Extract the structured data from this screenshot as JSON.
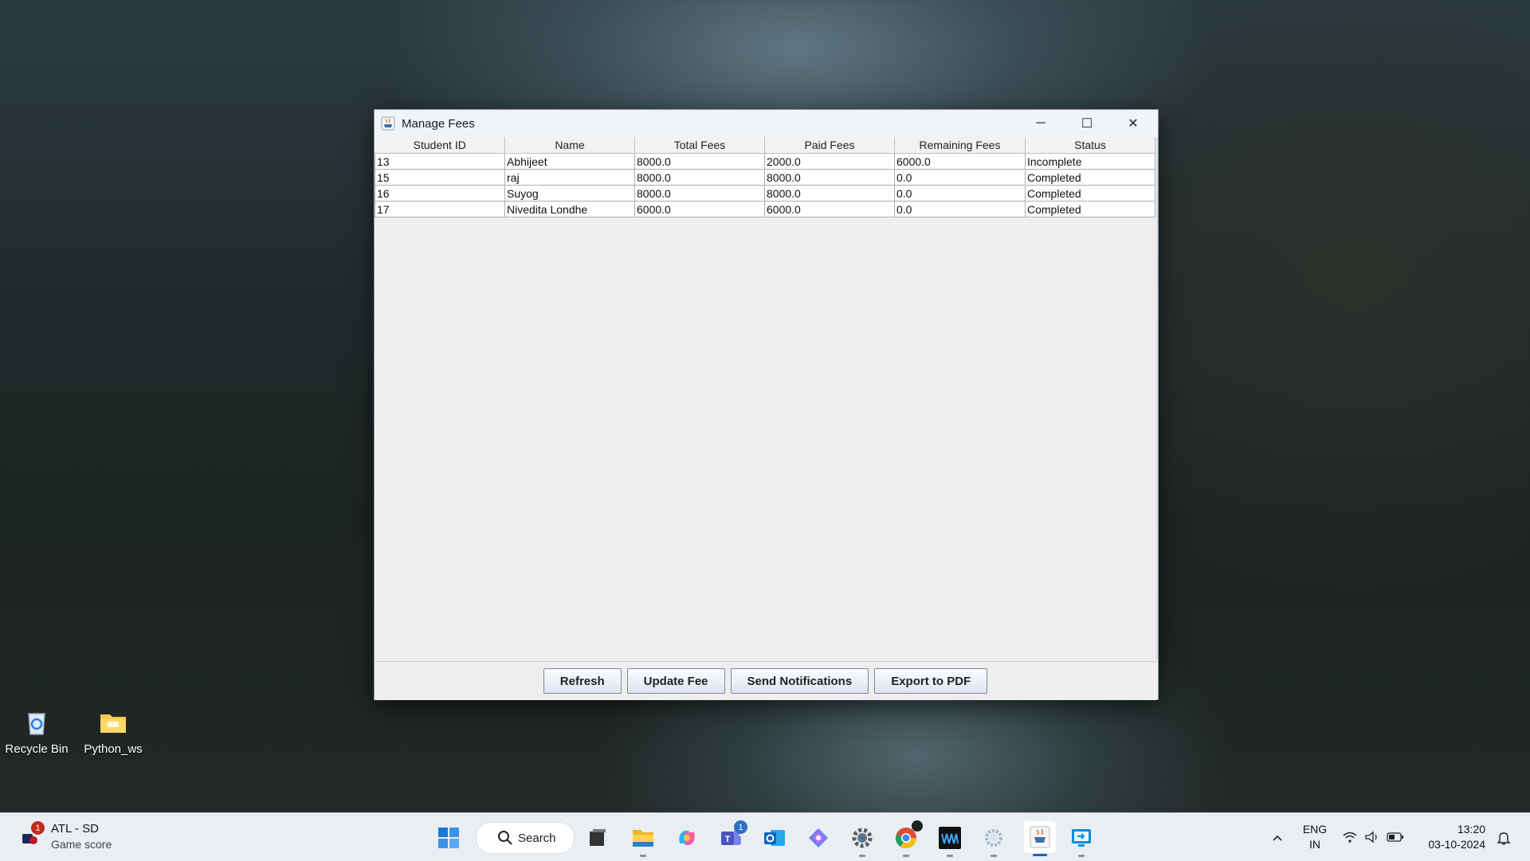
{
  "desktop": {
    "icons": [
      {
        "label": "Recycle Bin",
        "icon": "recycle-bin-icon"
      },
      {
        "label": "Python_ws",
        "icon": "folder-icon"
      }
    ]
  },
  "window": {
    "title": "Manage Fees",
    "icon": "java-icon",
    "controls": {
      "minimize": "─",
      "maximize": "☐",
      "close": "✕"
    }
  },
  "table": {
    "columns": [
      "Student ID",
      "Name",
      "Total Fees",
      "Paid Fees",
      "Remaining Fees",
      "Status"
    ],
    "rows": [
      [
        "13",
        "Abhijeet",
        "8000.0",
        "2000.0",
        "6000.0",
        "Incomplete"
      ],
      [
        "15",
        "raj",
        "8000.0",
        "8000.0",
        "0.0",
        "Completed"
      ],
      [
        "16",
        "Suyog",
        "8000.0",
        "8000.0",
        "0.0",
        "Completed"
      ],
      [
        "17",
        "Nivedita Londhe",
        "6000.0",
        "6000.0",
        "0.0",
        "Completed"
      ]
    ]
  },
  "buttons": {
    "refresh": "Refresh",
    "update_fee": "Update Fee",
    "send_notifications": "Send Notifications",
    "export_pdf": "Export to PDF"
  },
  "taskbar": {
    "widget": {
      "title": "ATL - SD",
      "subtitle": "Game score",
      "badge": "1"
    },
    "search_label": "Search",
    "apps": [
      {
        "icon": "start-icon"
      },
      {
        "icon": "task-view-icon"
      },
      {
        "icon": "file-explorer-icon"
      },
      {
        "icon": "copilot-icon"
      },
      {
        "icon": "teams-icon",
        "badge": "1"
      },
      {
        "icon": "outlook-icon"
      },
      {
        "icon": "photos-icon"
      },
      {
        "icon": "settings-icon"
      },
      {
        "icon": "chrome-icon"
      },
      {
        "icon": "waveform-app-icon"
      },
      {
        "icon": "gear-app-icon"
      },
      {
        "icon": "java-app-icon"
      },
      {
        "icon": "remote-app-icon"
      }
    ],
    "tray": {
      "lang_top": "ENG",
      "lang_bottom": "IN",
      "time": "13:20",
      "date": "03-10-2024"
    }
  },
  "colors": {
    "accent": "#0067c0",
    "badge": "#c42b1c"
  }
}
